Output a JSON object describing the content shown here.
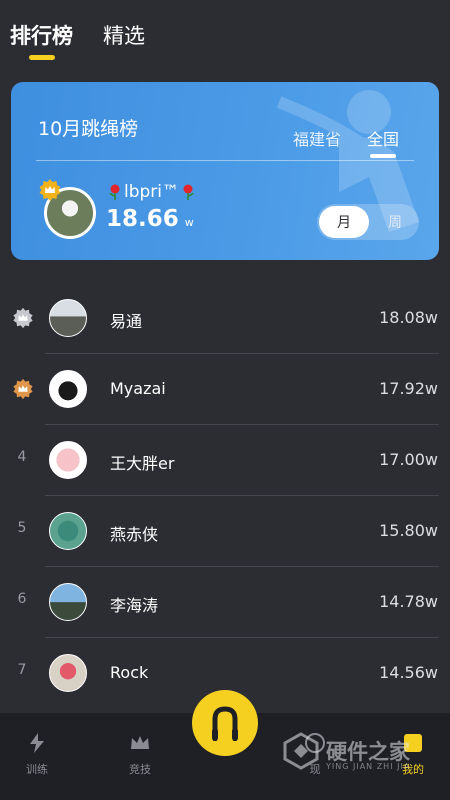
{
  "top_tabs": [
    {
      "label": "排行榜",
      "active": true
    },
    {
      "label": "精选",
      "active": false
    }
  ],
  "card": {
    "title": "10月跳绳榜",
    "region_tabs": [
      {
        "label": "福建省",
        "active": false
      },
      {
        "label": "全国",
        "active": true
      }
    ],
    "me": {
      "name": "lbpri™",
      "score": "18.66",
      "unit": "w"
    },
    "period": {
      "month": "月",
      "week": "周",
      "selected": "月"
    }
  },
  "ranking": [
    {
      "rank": "",
      "medal": "silver",
      "name": "易通",
      "score": "18.08w"
    },
    {
      "rank": "",
      "medal": "bronze",
      "name": "Myazai",
      "score": "17.92w"
    },
    {
      "rank": "4",
      "medal": "",
      "name": "王大胖er",
      "score": "17.00w"
    },
    {
      "rank": "5",
      "medal": "",
      "name": "燕赤侠",
      "score": "15.80w"
    },
    {
      "rank": "6",
      "medal": "",
      "name": "李海涛",
      "score": "14.78w"
    },
    {
      "rank": "7",
      "medal": "",
      "name": "Rock",
      "score": "14.56w"
    }
  ],
  "bottom_nav": {
    "train": "训练",
    "compete": "竞技",
    "discover": "现",
    "mine": "我的"
  },
  "watermark": {
    "text": "硬件之家",
    "sub": "YING JIAN ZHI JIA"
  },
  "colors": {
    "accent": "#f5d020",
    "card_blue": "#4a9ae6",
    "background": "#2c2d33"
  }
}
